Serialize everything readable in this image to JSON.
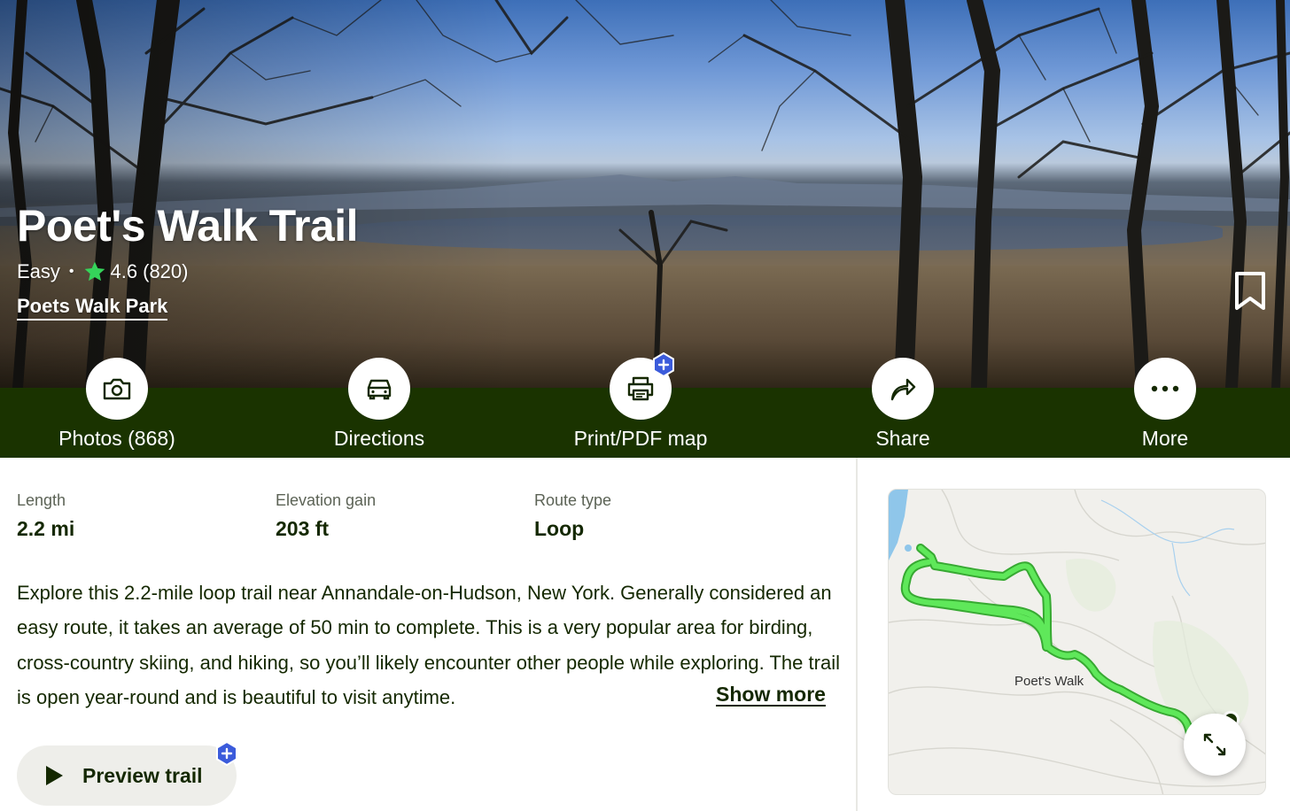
{
  "trail": {
    "name": "Poet's Walk Trail",
    "difficulty": "Easy",
    "separator": "•",
    "rating": "4.6",
    "review_count": "(820)",
    "park": "Poets Walk Park"
  },
  "actions": [
    {
      "label": "Photos (868)",
      "icon": "camera-icon"
    },
    {
      "label": "Directions",
      "icon": "car-icon"
    },
    {
      "label": "Print/PDF map",
      "icon": "printer-icon",
      "badge": "plus-badge"
    },
    {
      "label": "Share",
      "icon": "share-arrow-icon"
    },
    {
      "label": "More",
      "icon": "more-dots-icon"
    }
  ],
  "stats": [
    {
      "label": "Length",
      "value": "2.2 mi"
    },
    {
      "label": "Elevation gain",
      "value": "203 ft"
    },
    {
      "label": "Route type",
      "value": "Loop"
    }
  ],
  "description": "Explore this 2.2-mile loop trail near Annandale-on-Hudson, New York. Generally considered an easy route, it takes an average of 50 min to complete. This is a very popular area for birding, cross-country skiing, and hiking, so you’ll likely encounter other people while exploring. The trail is open year-round and is beautiful to visit anytime.",
  "show_more_label": "Show more",
  "preview_label": "Preview trail",
  "map": {
    "trail_label": "Poet's Walk",
    "route_color": "#3ddc3a",
    "expand_icon": "expand-arrows-icon"
  },
  "colors": {
    "action_bar": "#1a3300",
    "text_dark": "#142800",
    "star": "#35d35a",
    "plus_badge": "#3b5bdb"
  }
}
